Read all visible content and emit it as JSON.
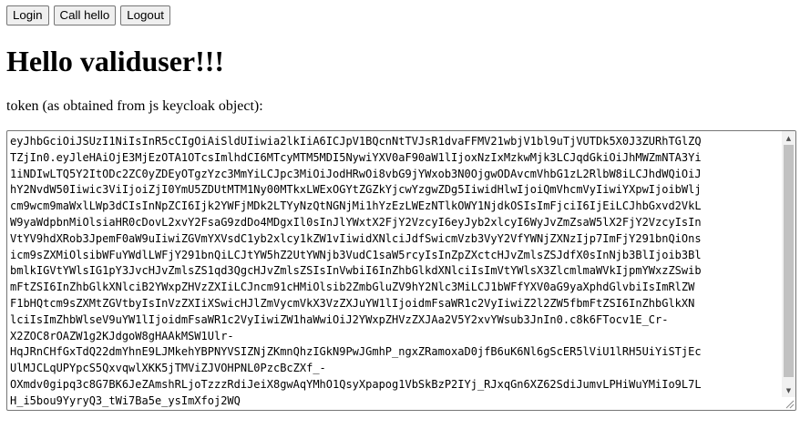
{
  "toolbar": {
    "login_label": "Login",
    "call_hello_label": "Call hello",
    "logout_label": "Logout"
  },
  "main": {
    "title": "Hello validuser!!!",
    "token_label": "token (as obtained from js keycloak object):",
    "token_lines": [
      "eyJhbGciOiJSUzI1NiIsInR5cCIgOiAiSldUIiwia2lkIiA6ICJpV1BQcnNtTVJsR1dvaFFMV21wbjV1bl9uTjVUTDk5X0J3ZURhTGlZQ",
      "TZjIn0.eyJleHAiOjE3MjEzOTA1OTcsImlhdCI6MTcyMTM5MDI5NywiYXV0aF90aW1lIjoxNzIxMzkwMjk3LCJqdGkiOiJhMWZmNTA3Yi",
      "1iNDIwLTQ5Y2ItODc2ZC0yZDEyOTgzYzc3MmYiLCJpc3MiOiJodHRwOi8vbG9jYWxob3N0OjgwODAvcmVhbG1zL2RlbW8iLCJhdWQiOiJ",
      "hY2NvdW50Iiwic3ViIjoiZjI0YmU5ZDUtMTM1Ny00MTkxLWExOGYtZGZkYjcwYzgwZDg5IiwidHlwIjoiQmVhcmVyIiwiYXpwIjoibWlj",
      "cm9wcm9maWxlLWp3dCIsInNpZCI6Ijk2YWFjMDk2LTYyNzQtNGNjMi1hYzEzLWEzNTlkOWY1NjdkOSIsImFjciI6IjEiLCJhbGxvd2VkL",
      "W9yaWdpbnMiOlsiaHR0cDovL2xvY2FsaG9zdDo4MDgxIl0sInJlYWxtX2FjY2VzcyI6eyJyb2xlcyI6WyJvZmZsaW5lX2FjY2VzcyIsIn",
      "VtYV9hdXRob3JpemF0aW9uIiwiZGVmYXVsdC1yb2xlcy1kZW1vIiwidXNlciJdfSwicmVzb3VyY2VfYWNjZXNzIjp7ImFjY291bnQiOns",
      "icm9sZXMiOlsibWFuYWdlLWFjY291bnQiLCJtYW5hZ2UtYWNjb3VudC1saW5rcyIsInZpZXctcHJvZmlsZSJdfX0sInNjb3BlIjoib3Bl",
      "bmlkIGVtYWlsIG1pY3JvcHJvZmlsZS1qd3QgcHJvZmlsZSIsInVwbiI6InZhbGlkdXNlciIsImVtYWlsX3ZlcmlmaWVkIjpmYWxzZSwib",
      "mFtZSI6InZhbGlkXNlciB2YWxpZHVzZXIiLCJncm91cHMiOlsib2ZmbGluZV9hY2Nlc3MiLCJ1bWFfYXV0aG9yaXphdGlvbiIsImRlZW",
      "F1bHQtcm9sZXMtZGVtbyIsInVzZXIiXSwicHJlZmVycmVkX3VzZXJuYW1lIjoidmFsaWR1c2VyIiwiZ2l2ZW5fbmFtZSI6InZhbGlkXN",
      "lciIsImZhbWlseV9uYW1lIjoidmFsaWR1c2VyIiwiZW1haWwiOiJ2YWxpZHVzZXJAa2V5Y2xvYWsub3JnIn0.c8k6FTocv1E_Cr-",
      "X2ZOC8rOAZW1g2KJdgoW8gHAAkMSW1Ulr-",
      "HqJRnCHfGxTdQ22dmYhnE9LJMkehYBPNYVSIZNjZKmnQhzIGkN9PwJGmhP_ngxZRamoxaD0jfB6uK6Nl6gScER5lViU1lRH5UiYiSTjEc",
      "UlMJCLqUPYpcS5QxvqwlXKK5jTMViZJVOHPNL0PzcBcZXf_-",
      "OXmdv0gipq3c8G7BK6JeZAmshRLjoTzzzRdiJeiX8gwAqYMhO1QsyXpapog1VbSkBzP2IYj_RJxqGn6XZ62SdiJumvLPHiWuYMiIo9L7L",
      "H_i5bou9YyryQ3_tWi7Ba5e_ysImXfoj2WQ"
    ]
  },
  "icons": {
    "scroll_up": "scroll-up-arrow-icon",
    "scroll_down": "scroll-down-arrow-icon",
    "resize": "resize-grip-icon"
  },
  "colors": {
    "button_bg": "#efefef",
    "border": "#767676",
    "scroll_track": "#f1f1f1",
    "scroll_thumb": "#c1c1c1"
  }
}
